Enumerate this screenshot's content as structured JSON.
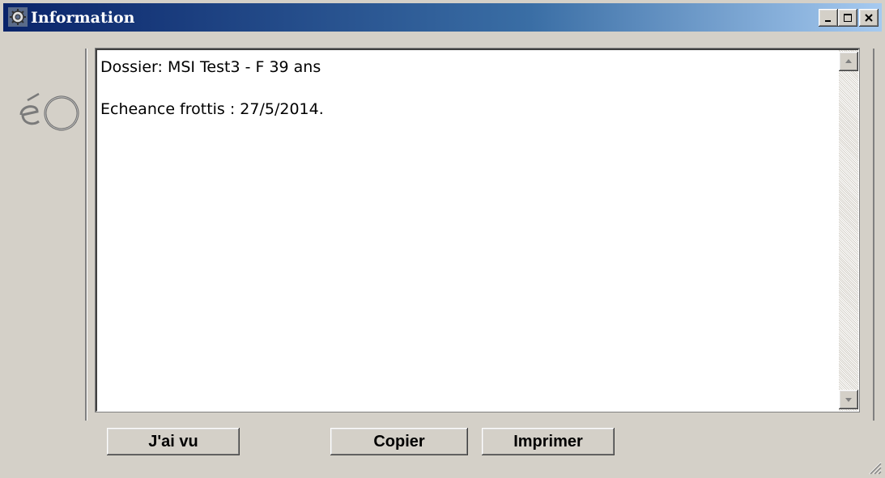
{
  "window": {
    "title": "Information",
    "icon": "gear-icon",
    "controls": {
      "minimize": "minimize-icon",
      "maximize": "maximize-icon",
      "close": "close-icon"
    }
  },
  "logo": {
    "icon": "eo-logo"
  },
  "content": {
    "line1": "Dossier: MSI Test3 - F 39 ans",
    "line2": "Echeance frottis : 27/5/2014."
  },
  "buttons": {
    "seen": "J'ai vu",
    "copy": "Copier",
    "print": "Imprimer"
  },
  "colors": {
    "titlebar_start": "#0a246a",
    "titlebar_end": "#a6caf0",
    "face": "#d4d0c8"
  }
}
